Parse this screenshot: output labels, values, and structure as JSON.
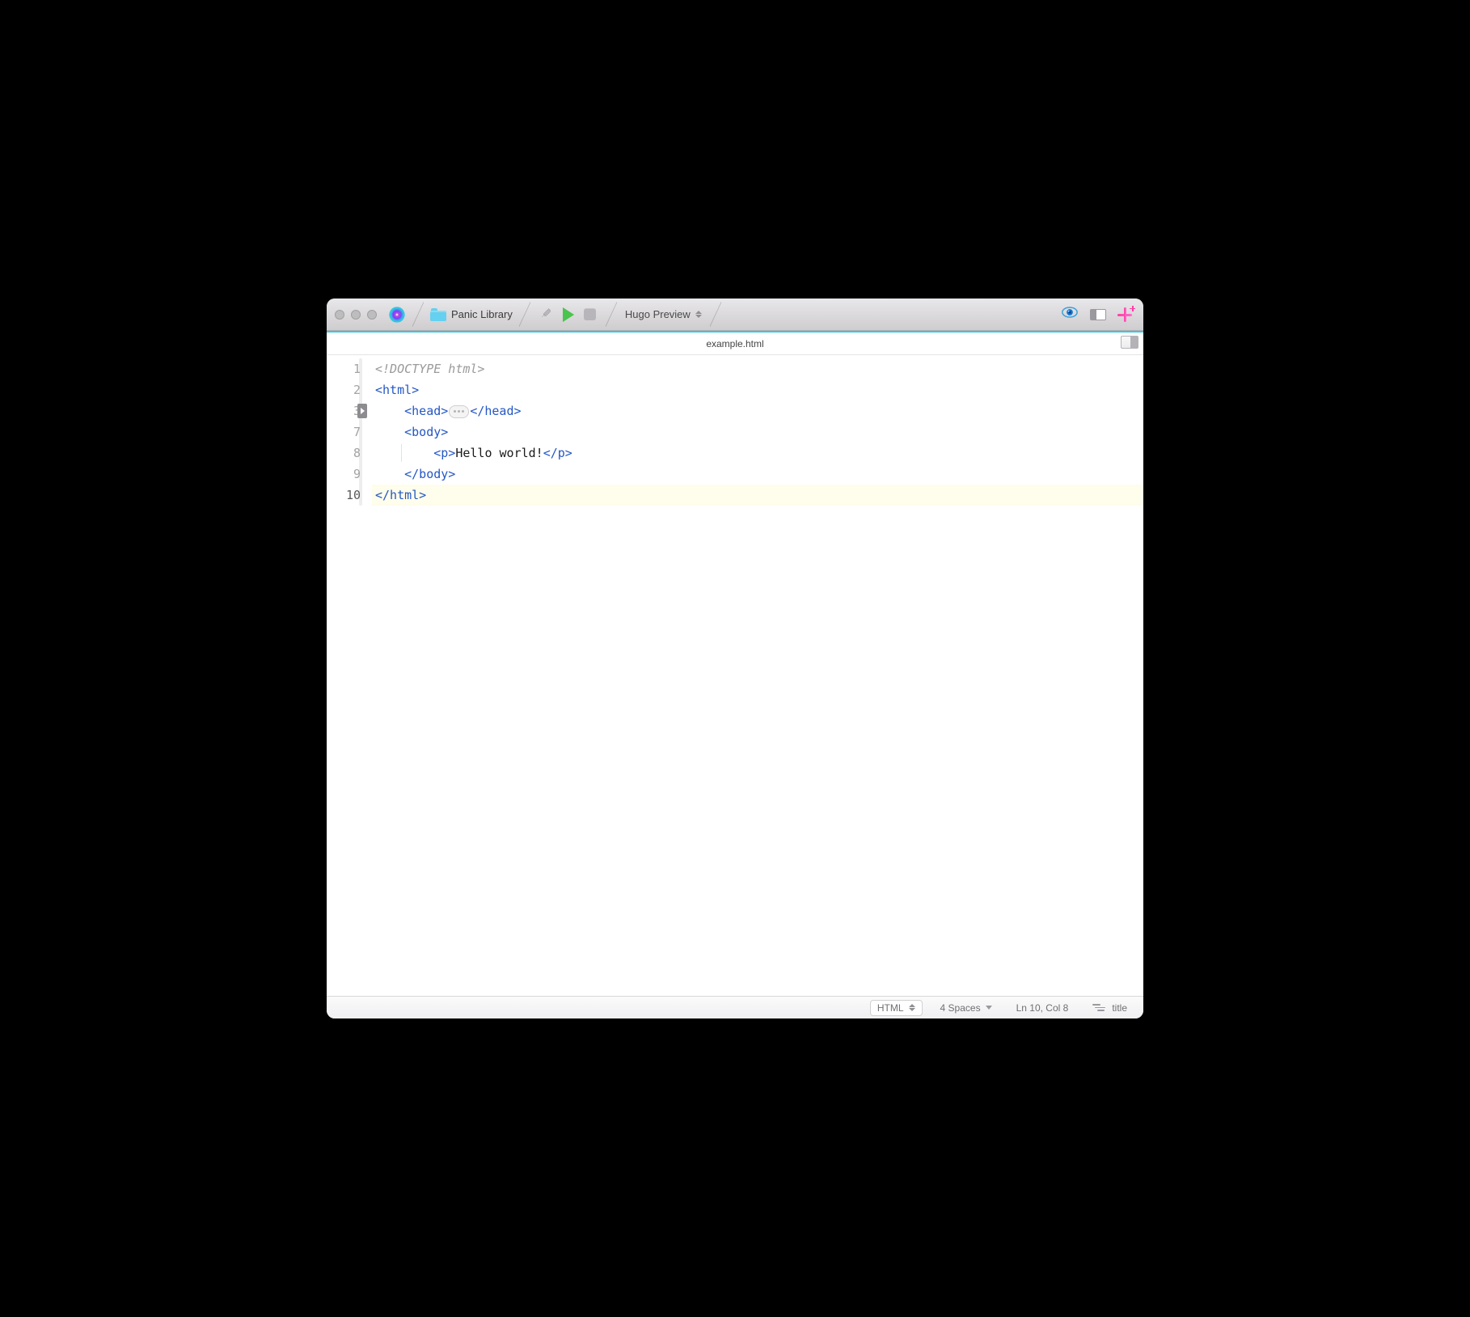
{
  "toolbar": {
    "project_name": "Panic Library",
    "task_name": "Hugo Preview"
  },
  "tab": {
    "filename": "example.html"
  },
  "code": {
    "lines": [
      {
        "num": "1",
        "tokens": [
          {
            "t": "<!DOCTYPE html>",
            "c": "tk-doctype"
          }
        ]
      },
      {
        "num": "2",
        "tokens": [
          {
            "t": "<html>",
            "c": "tk-tag"
          }
        ]
      },
      {
        "num": "3",
        "fold": true,
        "indent": 1,
        "tokens": [
          {
            "t": "<head>",
            "c": "tk-tag"
          },
          {
            "pill": true
          },
          {
            "t": "</head>",
            "c": "tk-tag"
          }
        ]
      },
      {
        "num": "7",
        "indent": 1,
        "tokens": [
          {
            "t": "<body>",
            "c": "tk-tag"
          }
        ]
      },
      {
        "num": "8",
        "indent": 2,
        "guide": true,
        "tokens": [
          {
            "t": "<p>",
            "c": "tk-tag"
          },
          {
            "t": "Hello world!",
            "c": "tk-text"
          },
          {
            "t": "</p>",
            "c": "tk-tag"
          }
        ]
      },
      {
        "num": "9",
        "indent": 1,
        "tokens": [
          {
            "t": "</body>",
            "c": "tk-tag"
          }
        ]
      },
      {
        "num": "10",
        "active": true,
        "tokens": [
          {
            "t": "</html>",
            "c": "tk-tag"
          }
        ]
      }
    ]
  },
  "status": {
    "syntax": "HTML",
    "indent": "4 Spaces",
    "position": "Ln 10, Col 8",
    "symbols": "title"
  }
}
